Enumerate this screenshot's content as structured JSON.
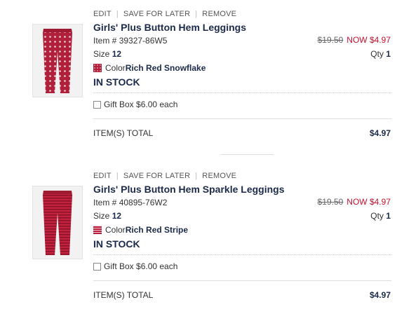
{
  "actions": {
    "edit": "EDIT",
    "save_for_later": "SAVE FOR LATER",
    "remove": "REMOVE"
  },
  "labels": {
    "item_prefix": "Item # ",
    "size_prefix": "Size ",
    "color_prefix": "Color ",
    "qty_prefix": "Qty ",
    "in_stock": "IN STOCK",
    "gift_box": "Gift Box $6.00 each",
    "items_total": "ITEM(S) TOTAL"
  },
  "items": [
    {
      "title": "Girls' Plus Button Hem Leggings",
      "item_number": "39327-86W5",
      "size": "12",
      "color": "Rich Red Snowflake",
      "was_price": "$19.50",
      "now_price": "NOW $4.97",
      "qty": "1",
      "total": "$4.97",
      "pattern": "snowflake",
      "swatch_color": "#b0203a"
    },
    {
      "title": "Girls' Plus Button Hem Sparkle Leggings",
      "item_number": "40895-76W2",
      "size": "12",
      "color": "Rich Red Stripe",
      "was_price": "$19.50",
      "now_price": "NOW $4.97",
      "qty": "1",
      "total": "$4.97",
      "pattern": "stripe",
      "swatch_color": "#b81e3a"
    }
  ],
  "colors": {
    "accent_red": "#c8102e",
    "navy_text": "#1b2a4a"
  }
}
